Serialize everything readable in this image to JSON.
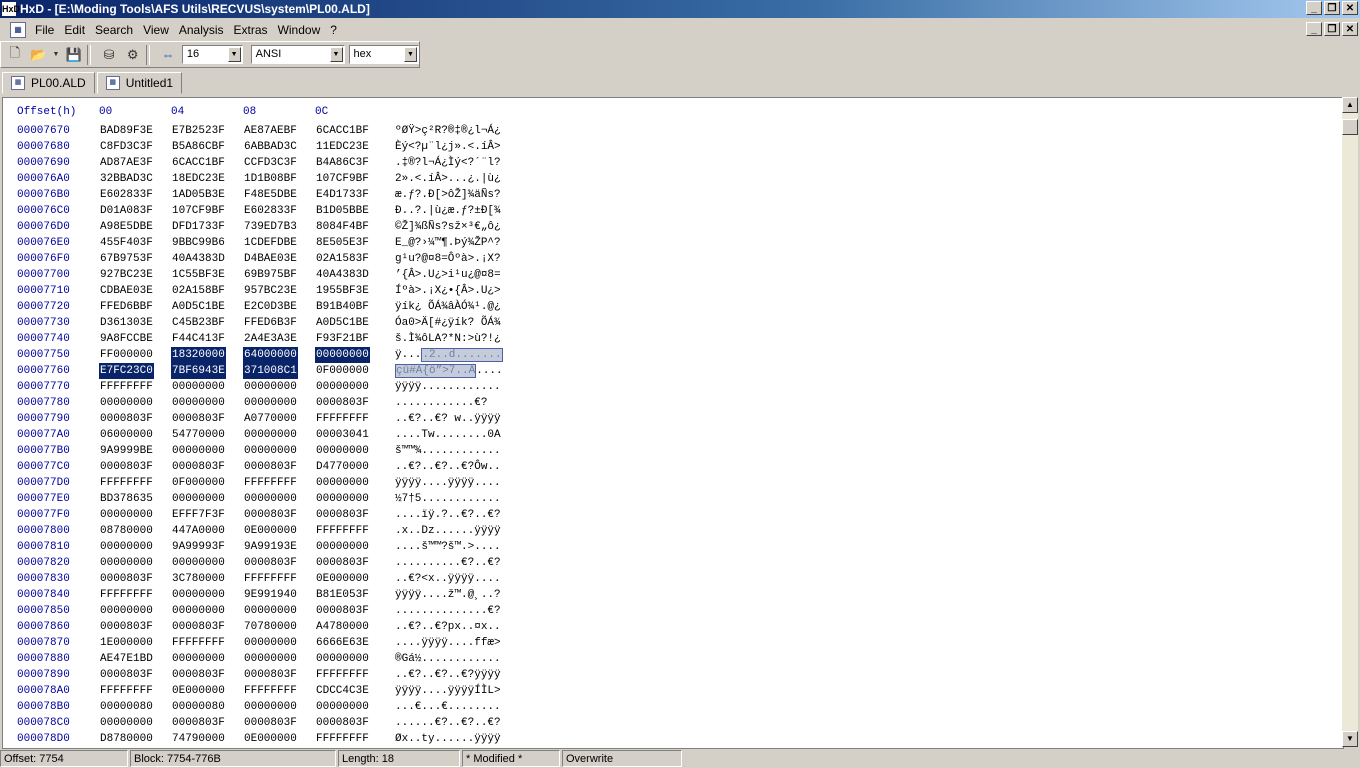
{
  "window": {
    "title": "HxD - [E:\\Moding Tools\\AFS Utils\\RECVUS\\system\\PL00.ALD]",
    "app_icon": "HxD"
  },
  "menu": [
    "File",
    "Edit",
    "Search",
    "View",
    "Analysis",
    "Extras",
    "Window",
    "?"
  ],
  "toolbar": {
    "bytes_per_row": "16",
    "charset": "ANSI",
    "mode": "hex"
  },
  "tabs": [
    {
      "label": "PL00.ALD",
      "active": true
    },
    {
      "label": "Untitled1",
      "active": false
    }
  ],
  "editor": {
    "header": {
      "offset": "Offset(h)",
      "cols": [
        "00",
        "04",
        "08",
        "0C"
      ]
    },
    "rows": [
      {
        "offset": "00007670",
        "hex": [
          "BAD89F3E",
          "E7B2523F",
          "AE87AEBF",
          "6CACC1BF"
        ],
        "ascii": "ºØŸ>ç²R?®‡®¿l¬Á¿"
      },
      {
        "offset": "00007680",
        "hex": [
          "C8FD3C3F",
          "B5A86CBF",
          "6ABBAD3C",
          "11EDC23E"
        ],
        "ascii": "Èý<?µ¨l¿j».<.íÂ>"
      },
      {
        "offset": "00007690",
        "hex": [
          "AD87AE3F",
          "6CACC1BF",
          "CCFD3C3F",
          "B4A86C3F"
        ],
        "ascii": ".‡®?l¬Á¿Ìý<?´¨l?"
      },
      {
        "offset": "000076A0",
        "hex": [
          "32BBAD3C",
          "18EDC23E",
          "1D1B08BF",
          "107CF9BF"
        ],
        "ascii": "2».<.íÂ>...¿.|ù¿"
      },
      {
        "offset": "000076B0",
        "hex": [
          "E602833F",
          "1AD05B3E",
          "F48E5DBE",
          "E4D1733F"
        ],
        "ascii": "æ.ƒ?.Ð[>ôŽ]¾äÑs?"
      },
      {
        "offset": "000076C0",
        "hex": [
          "D01A083F",
          "107CF9BF",
          "E602833F",
          "B1D05BBE"
        ],
        "ascii": "Ð..?.|ù¿æ.ƒ?±Ð[¾"
      },
      {
        "offset": "000076D0",
        "hex": [
          "A98E5DBE",
          "DFD1733F",
          "739ED7B3",
          "8084F4BF"
        ],
        "ascii": "©Ž]¾ßÑs?sž×³€„ô¿"
      },
      {
        "offset": "000076E0",
        "hex": [
          "455F403F",
          "9BBC99B6",
          "1CDEFDBE",
          "8E505E3F"
        ],
        "ascii": "E_@?›¼™¶.Þý¾ŽP^?"
      },
      {
        "offset": "000076F0",
        "hex": [
          "67B9753F",
          "40A4383D",
          "D4BAE03E",
          "02A1583F"
        ],
        "ascii": "g¹u?@¤8=Ôºà>.¡X?"
      },
      {
        "offset": "00007700",
        "hex": [
          "927BC23E",
          "1C55BF3E",
          "69B975BF",
          "40A4383D"
        ],
        "ascii": "’{Â>.U¿>i¹u¿@¤8="
      },
      {
        "offset": "00007710",
        "hex": [
          "CDBAE03E",
          "02A158BF",
          "957BC23E",
          "1955BF3E"
        ],
        "ascii": "Íºà>.¡X¿•{Â>.U¿>"
      },
      {
        "offset": "00007720",
        "hex": [
          "FFED6BBF",
          "A0D5C1BE",
          "E2C0D3BE",
          "B91B40BF"
        ],
        "ascii": "ÿík¿ ÕÁ¾âÀÓ¾¹.@¿"
      },
      {
        "offset": "00007730",
        "hex": [
          "D361303E",
          "C45B23BF",
          "FFED6B3F",
          "A0D5C1BE"
        ],
        "ascii": "Óa0>Ä[#¿ÿík? ÕÁ¾"
      },
      {
        "offset": "00007740",
        "hex": [
          "9A8FCCBE",
          "F44C413F",
          "2A4E3A3E",
          "F93F21BF"
        ],
        "ascii": "š.Ì¾ôLA?*N:>ù?!¿"
      },
      {
        "offset": "00007750",
        "hex": [
          "FF000000",
          "18320000",
          "64000000",
          "00000000"
        ],
        "ascii": "ÿ....2..d......."
      },
      {
        "offset": "00007760",
        "hex": [
          "E7FC23C0",
          "7BF6943E",
          "371008C1",
          "0F000000"
        ],
        "ascii": "çü#À{ö”>7..Á...."
      },
      {
        "offset": "00007770",
        "hex": [
          "FFFFFFFF",
          "00000000",
          "00000000",
          "00000000"
        ],
        "ascii": "ÿÿÿÿ............"
      },
      {
        "offset": "00007780",
        "hex": [
          "00000000",
          "00000000",
          "00000000",
          "0000803F"
        ],
        "ascii": "............€?"
      },
      {
        "offset": "00007790",
        "hex": [
          "0000803F",
          "0000803F",
          "A0770000",
          "FFFFFFFF"
        ],
        "ascii": "..€?..€? w..ÿÿÿÿ"
      },
      {
        "offset": "000077A0",
        "hex": [
          "06000000",
          "54770000",
          "00000000",
          "00003041"
        ],
        "ascii": "....Tw........0A"
      },
      {
        "offset": "000077B0",
        "hex": [
          "9A9999BE",
          "00000000",
          "00000000",
          "00000000"
        ],
        "ascii": "š™™¾............"
      },
      {
        "offset": "000077C0",
        "hex": [
          "0000803F",
          "0000803F",
          "0000803F",
          "D4770000"
        ],
        "ascii": "..€?..€?..€?Ôw.."
      },
      {
        "offset": "000077D0",
        "hex": [
          "FFFFFFFF",
          "0F000000",
          "FFFFFFFF",
          "00000000"
        ],
        "ascii": "ÿÿÿÿ....ÿÿÿÿ...."
      },
      {
        "offset": "000077E0",
        "hex": [
          "BD378635",
          "00000000",
          "00000000",
          "00000000"
        ],
        "ascii": "½7†5............"
      },
      {
        "offset": "000077F0",
        "hex": [
          "00000000",
          "EFFF7F3F",
          "0000803F",
          "0000803F"
        ],
        "ascii": "....ïÿ.?..€?..€?"
      },
      {
        "offset": "00007800",
        "hex": [
          "08780000",
          "447A0000",
          "0E000000",
          "FFFFFFFF"
        ],
        "ascii": ".x..Dz......ÿÿÿÿ"
      },
      {
        "offset": "00007810",
        "hex": [
          "00000000",
          "9A99993F",
          "9A99193E",
          "00000000"
        ],
        "ascii": "....š™™?š™.>...."
      },
      {
        "offset": "00007820",
        "hex": [
          "00000000",
          "00000000",
          "0000803F",
          "0000803F"
        ],
        "ascii": "..........€?..€?"
      },
      {
        "offset": "00007830",
        "hex": [
          "0000803F",
          "3C780000",
          "FFFFFFFF",
          "0E000000"
        ],
        "ascii": "..€?<x..ÿÿÿÿ...."
      },
      {
        "offset": "00007840",
        "hex": [
          "FFFFFFFF",
          "00000000",
          "9E991940",
          "B81E053F"
        ],
        "ascii": "ÿÿÿÿ....ž™.@¸..?"
      },
      {
        "offset": "00007850",
        "hex": [
          "00000000",
          "00000000",
          "00000000",
          "0000803F"
        ],
        "ascii": "..............€?"
      },
      {
        "offset": "00007860",
        "hex": [
          "0000803F",
          "0000803F",
          "70780000",
          "A4780000"
        ],
        "ascii": "..€?..€?px..¤x.."
      },
      {
        "offset": "00007870",
        "hex": [
          "1E000000",
          "FFFFFFFF",
          "00000000",
          "6666E63E"
        ],
        "ascii": "....ÿÿÿÿ....ffæ>"
      },
      {
        "offset": "00007880",
        "hex": [
          "AE47E1BD",
          "00000000",
          "00000000",
          "00000000"
        ],
        "ascii": "®Gá½............"
      },
      {
        "offset": "00007890",
        "hex": [
          "0000803F",
          "0000803F",
          "0000803F",
          "FFFFFFFF"
        ],
        "ascii": "..€?..€?..€?ÿÿÿÿ"
      },
      {
        "offset": "000078A0",
        "hex": [
          "FFFFFFFF",
          "0E000000",
          "FFFFFFFF",
          "CDCC4C3E"
        ],
        "ascii": "ÿÿÿÿ....ÿÿÿÿÍÌL>"
      },
      {
        "offset": "000078B0",
        "hex": [
          "00000080",
          "00000080",
          "00000000",
          "00000000"
        ],
        "ascii": "...€...€........"
      },
      {
        "offset": "000078C0",
        "hex": [
          "00000000",
          "0000803F",
          "0000803F",
          "0000803F"
        ],
        "ascii": "......€?..€?..€?"
      },
      {
        "offset": "000078D0",
        "hex": [
          "D8780000",
          "74790000",
          "0E000000",
          "FFFFFFFF"
        ],
        "ascii": "Øx..ty......ÿÿÿÿ"
      }
    ]
  },
  "status": {
    "offset": "Offset: 7754",
    "block": "Block: 7754-776B",
    "length": "Length: 18",
    "modified": "* Modified *",
    "mode": "Overwrite"
  }
}
